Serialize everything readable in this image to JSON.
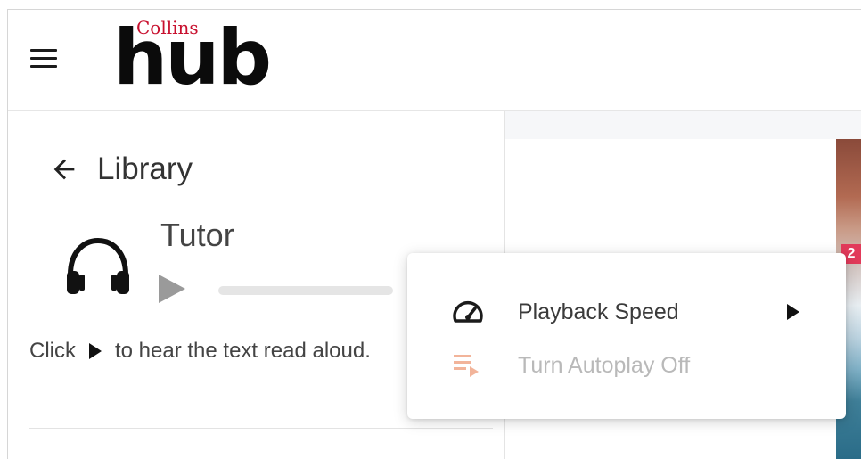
{
  "header": {
    "logo_top": "Collins",
    "logo_main": "hub",
    "accent_color": "#c8102e"
  },
  "nav": {
    "back_label": "Library"
  },
  "audio": {
    "title": "Tutor",
    "progress": 0,
    "hint_before": "Click",
    "hint_after": "to hear the text read aloud."
  },
  "cover": {
    "badge": "2"
  },
  "menu": {
    "items": [
      {
        "label": "Playback Speed",
        "icon": "speedometer-icon",
        "has_submenu": true,
        "disabled": false
      },
      {
        "label": "Turn Autoplay Off",
        "icon": "playlist-play-icon",
        "has_submenu": false,
        "disabled": true
      }
    ],
    "disabled_icon_color": "#f2b49a"
  }
}
